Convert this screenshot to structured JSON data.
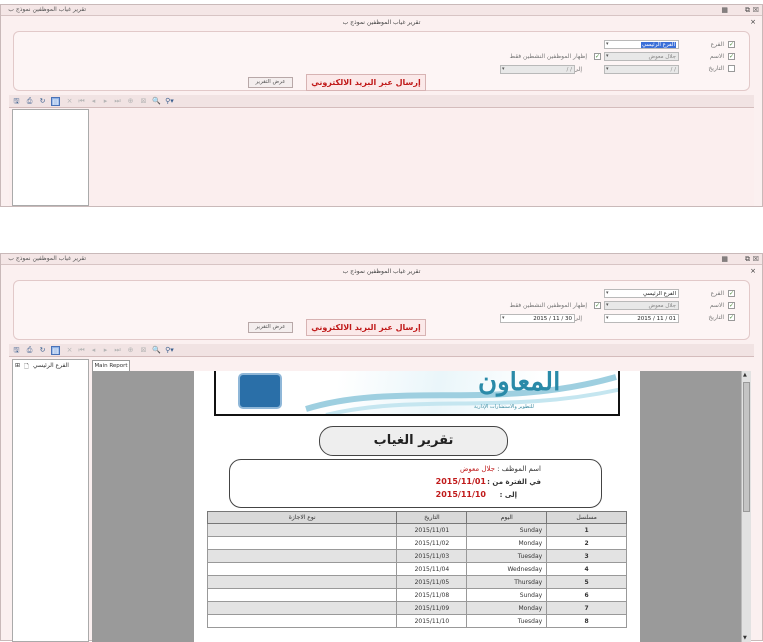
{
  "window_title": "تقرير غياب الموظفين نموذج ب",
  "report_subtitle": "تقرير غياب الموظفين نموذج ب",
  "filters": {
    "branch_label": "الفرع",
    "name_label": "الاسم",
    "date_label": "التاريخ",
    "branch_value": "الفرع الرئيسي",
    "name_value": "جلال معوض",
    "active_only_label": "إظهار الموظفين النشطين فقط",
    "to_label": "إلى",
    "date_from_empty": "/   /",
    "date_to_empty": "/   /",
    "date_from": "01 / 11 / 2015",
    "date_to": "30 / 11 / 2015"
  },
  "buttons": {
    "email": "إرسال عبر البريد الالكتروني",
    "show_report": "عرض التقرير"
  },
  "tree": {
    "root": "الفرع الرئيسي"
  },
  "tabs": {
    "main_report": "Main Report"
  },
  "report": {
    "logo_text": "المعاون",
    "logo_tagline": "للتطوير والاستشارات الإدارية",
    "title": "تقرير الغياب",
    "employee_label": "اسم الموظف :",
    "employee_name": "جلال معوض",
    "period_from_label": "في الفترة من :",
    "period_from": "2015/11/01",
    "period_to_label": "إلى :",
    "period_to": "2015/11/10",
    "columns": [
      "مسلسل",
      "اليوم",
      "التاريخ",
      "نوع الاجازة"
    ],
    "rows": [
      {
        "n": "1",
        "day": "Sunday",
        "date": "2015/11/01",
        "type": ""
      },
      {
        "n": "2",
        "day": "Monday",
        "date": "2015/11/02",
        "type": ""
      },
      {
        "n": "3",
        "day": "Tuesday",
        "date": "2015/11/03",
        "type": ""
      },
      {
        "n": "4",
        "day": "Wednesday",
        "date": "2015/11/04",
        "type": ""
      },
      {
        "n": "5",
        "day": "Thursday",
        "date": "2015/11/05",
        "type": ""
      },
      {
        "n": "6",
        "day": "Sunday",
        "date": "2015/11/08",
        "type": ""
      },
      {
        "n": "7",
        "day": "Monday",
        "date": "2015/11/09",
        "type": ""
      },
      {
        "n": "8",
        "day": "Tuesday",
        "date": "2015/11/10",
        "type": ""
      }
    ]
  },
  "colors": {
    "accent_red": "#c01a1a",
    "selection_blue": "#3a6fd8",
    "logo_teal": "#2a8aa8"
  }
}
